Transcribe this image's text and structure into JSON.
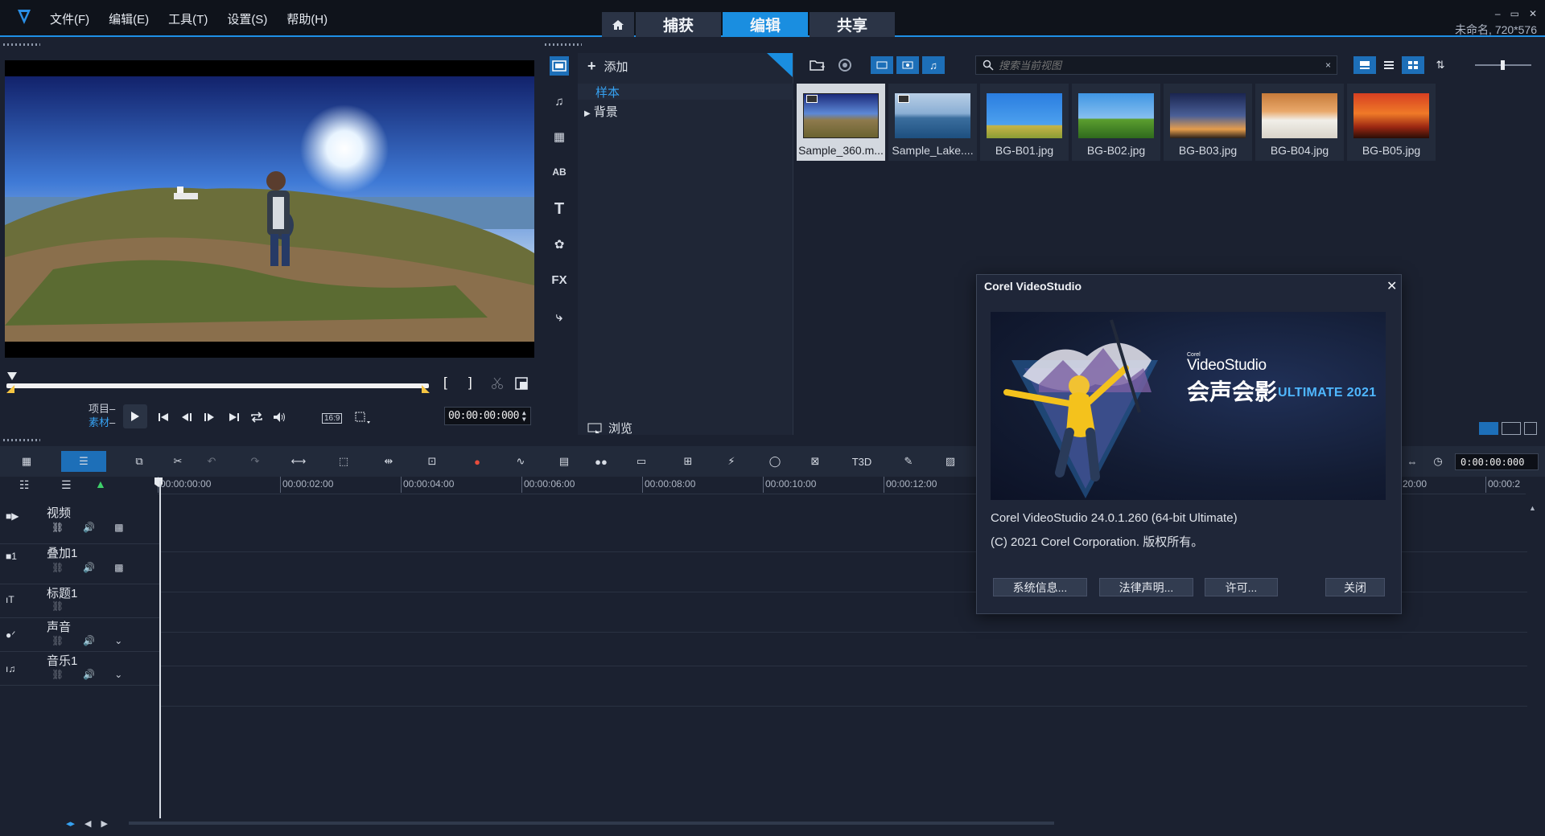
{
  "app": {
    "menu": [
      "文件(F)",
      "编辑(E)",
      "工具(T)",
      "设置(S)",
      "帮助(H)"
    ],
    "mode_tabs": {
      "capture": "捕获",
      "edit": "编辑",
      "share": "共享"
    },
    "project_info": "未命名, 720*576",
    "window_controls": {
      "minimize": "–",
      "restore": "▭",
      "close": "✕"
    }
  },
  "preview": {
    "mode_project": "项目",
    "mode_clip": "素材",
    "bracket_in": "[",
    "bracket_out": "]",
    "aspect_ratio": "16:9",
    "timecode": "00:00:00:000"
  },
  "library": {
    "add_label": "添加",
    "tree": {
      "selected": "样本",
      "folder": "背景"
    },
    "browse_label": "浏览",
    "search_placeholder": "搜索当前视图",
    "search_clear": "×",
    "thumbnails": [
      {
        "label": "Sample_360.m...",
        "selected": true
      },
      {
        "label": "Sample_Lake...."
      },
      {
        "label": "BG-B01.jpg"
      },
      {
        "label": "BG-B02.jpg"
      },
      {
        "label": "BG-B03.jpg"
      },
      {
        "label": "BG-B04.jpg"
      },
      {
        "label": "BG-B05.jpg"
      }
    ],
    "tools": [
      "media-icon",
      "instant-project-icon",
      "transition-icon",
      "title-icon",
      "text-icon",
      "graphics-icon",
      "fx-filter-icon",
      "path-icon"
    ],
    "fx_label": "FX"
  },
  "timeline": {
    "timecode": "0:00:00:000",
    "ruler": [
      "00:00:00:00",
      "00:00:02:00",
      "00:00:04:00",
      "00:00:06:00",
      "00:00:08:00",
      "00:00:10:00",
      "00:00:12:00",
      "20:00",
      "00:00:2"
    ],
    "tracks": [
      {
        "name": "视频"
      },
      {
        "name": "叠加1"
      },
      {
        "name": "标题1"
      },
      {
        "name": "声音"
      },
      {
        "name": "音乐1"
      }
    ],
    "text_3d_label": "T3D"
  },
  "about": {
    "title": "Corel VideoStudio",
    "close_glyph": "✕",
    "banner": {
      "corel": "Corel",
      "product": "VideoStudio",
      "cn_name": "会声会影",
      "edition": "ULTIMATE 2021"
    },
    "version": "Corel VideoStudio 24.0.1.260  (64-bit Ultimate)",
    "copyright": "(C) 2021 Corel Corporation. 版权所有。",
    "buttons": {
      "sysinfo": "系统信息...",
      "legal": "法律声明...",
      "license": "许可...",
      "close": "关闭"
    }
  },
  "colors": {
    "accent": "#1a8ee0",
    "background": "#1b2130",
    "panel": "#1f2636",
    "selected_text": "#36a2f2"
  }
}
